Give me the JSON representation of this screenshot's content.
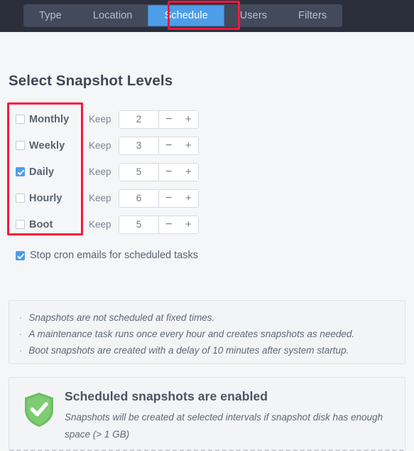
{
  "tabs": {
    "items": [
      {
        "label": "Type",
        "selected": false
      },
      {
        "label": "Location",
        "selected": false
      },
      {
        "label": "Schedule",
        "selected": true
      },
      {
        "label": "Users",
        "selected": false
      },
      {
        "label": "Filters",
        "selected": false
      }
    ],
    "selected_label": "Schedule",
    "selected_bg": "#4d9de8",
    "bar_bg": "#2b2e3b",
    "group_bg": "#434a5c",
    "annotation_color": "#f8173e"
  },
  "main": {
    "title": "Select Snapshot Levels",
    "keep_label": "Keep",
    "minus_glyph": "−",
    "plus_glyph": "+",
    "levels": [
      {
        "name": "Monthly",
        "checked": false,
        "keep": "2"
      },
      {
        "name": "Weekly",
        "checked": false,
        "keep": "3"
      },
      {
        "name": "Daily",
        "checked": true,
        "keep": "5"
      },
      {
        "name": "Hourly",
        "checked": false,
        "keep": "6"
      },
      {
        "name": "Boot",
        "checked": false,
        "keep": "5"
      }
    ],
    "cron": {
      "label": "Stop cron emails for scheduled tasks",
      "checked": true
    },
    "notes": {
      "bullet": "·",
      "lines": [
        "Snapshots are not scheduled at fixed times.",
        "A maintenance task runs once every hour and creates snapshots as needed.",
        "Boot snapshots are created with a delay of 10 minutes after system startup."
      ]
    },
    "status": {
      "icon": "shield-check-icon",
      "icon_color": "#6dbf63",
      "title": "Scheduled snapshots are enabled",
      "description": "Snapshots will be created at selected intervals if snapshot disk has enough space (> 1 GB)"
    }
  }
}
